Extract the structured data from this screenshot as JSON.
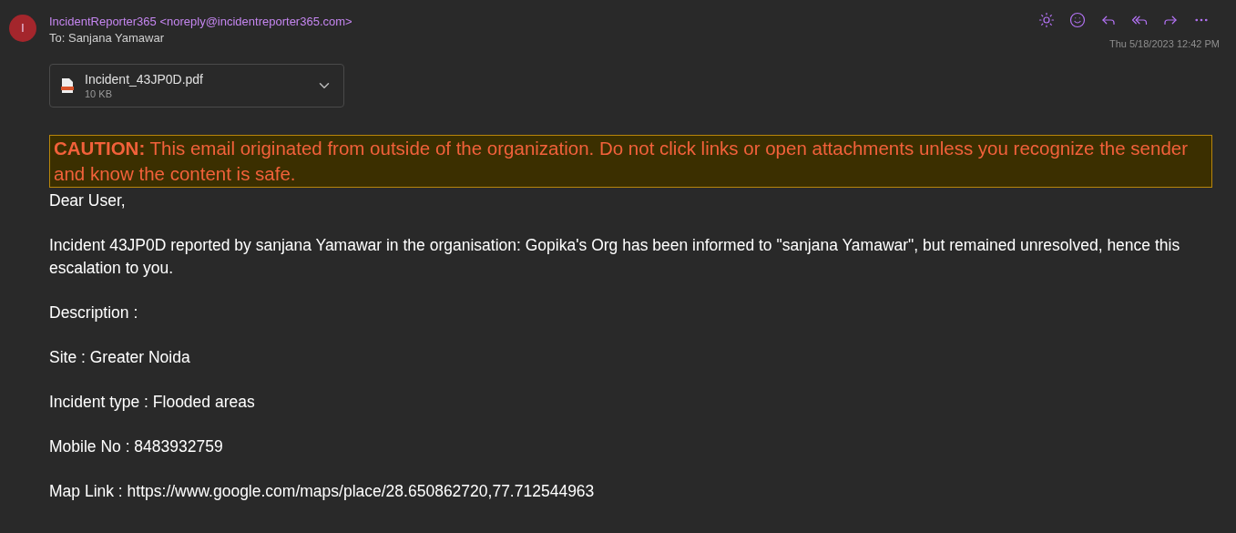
{
  "header": {
    "avatar_initial": "I",
    "sender_name": "IncidentReporter365",
    "sender_address": "<noreply@incidentreporter365.com>",
    "to_label": "To:",
    "to_name": "Sanjana Yamawar",
    "date": "Thu 5/18/2023 12:42 PM"
  },
  "attachment": {
    "name": "Incident_43JP0D.pdf",
    "size": "10 KB"
  },
  "caution": "**CAUTION:** This email originated from outside of the organization. Do not click links or open attachments unless you recognize the sender and know the content is safe.",
  "body": [
    "Dear User,",
    "Incident 43JP0D reported by sanjana Yamawar in the organisation: Gopika's Org has been informed to \"sanjana Yamawar\", but remained unresolved, hence this escalation to you.",
    "Description :",
    "Site : Greater Noida",
    "Incident type : Flooded areas",
    "Mobile No : 8483932759",
    "Map Link : https://www.google.com/maps/place/28.650862720,77.712544963"
  ]
}
